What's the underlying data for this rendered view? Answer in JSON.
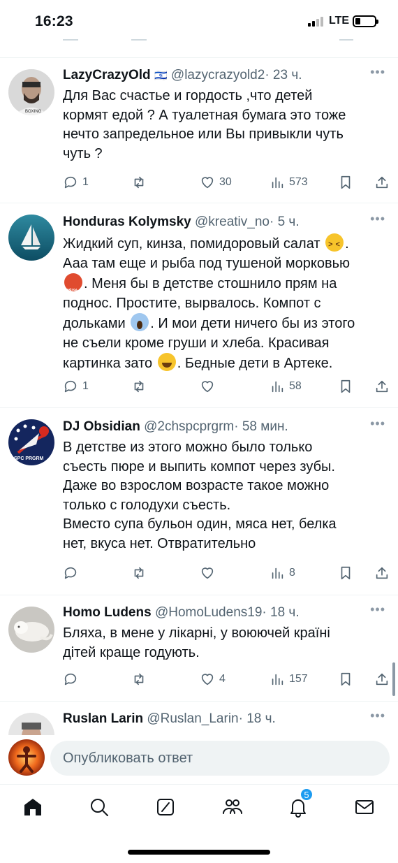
{
  "status_bar": {
    "time": "16:23",
    "network": "LTE"
  },
  "tweets": [
    {
      "name": "LazyCrazyOld",
      "flag": "🇮🇱",
      "handle": "@lazycrazyold2",
      "time": "· 23 ч.",
      "lines": [
        "Для Вас счастье и гордость ,что детей",
        "кормят едой ? А туалетная бумага это тоже",
        "нечто запредельное или Вы привыкли чуть",
        "чуть ?"
      ],
      "replies": "1",
      "retweets": "",
      "likes": "30",
      "views": "573"
    },
    {
      "name": "Honduras Kolymsky",
      "handle": "@kreativ_no",
      "time": "· 5 ч.",
      "lines": [
        "Жидкий суп, кинза, помидоровый салат",
        "Ааа там еще и рыба под тушеной морковью",
        ". Меня бы в детстве стошнило прям на",
        "поднос. Простите, вырвалось. Компот с",
        "дольками",
        ". И мои дети ничего бы из этого",
        "не съели кроме груши и хлеба. Красивая",
        "картинка зато",
        ". Бедные дети в Артеке."
      ],
      "replies": "1",
      "retweets": "",
      "likes": "",
      "views": "58"
    },
    {
      "name": "DJ Obsidian",
      "handle": "@2chspcprgrm",
      "time": "· 58 мин.",
      "avatar_text": "SPC PRGRM",
      "lines": [
        "В детстве из этого можно было только",
        "съесть пюре и выпить компот через зубы.",
        "Даже во взрослом возрасте такое можно",
        "только с голодухи съесть.",
        "Вместо супа бульон один, мяса нет, белка",
        "нет, вкуса нет. Отвратительно"
      ],
      "replies": "",
      "retweets": "",
      "likes": "",
      "views": "8"
    },
    {
      "name": "Homo Ludens",
      "handle": "@HomoLudens19",
      "time": "· 18 ч.",
      "lines": [
        "Бляха, в мене у лікарні, у воюючей країні",
        "дітей краще годують."
      ],
      "replies": "",
      "retweets": "",
      "likes": "4",
      "views": "157"
    },
    {
      "name": "Ruslan Larin",
      "handle": "@Ruslan_Larin",
      "time": "· 18 ч."
    }
  ],
  "reply_bar": {
    "placeholder": "Опубликовать ответ"
  },
  "tab_bar": {
    "notifications_badge": "5"
  },
  "colors": {
    "accent": "#1d9bf0",
    "secondary_text": "#536471",
    "divider": "#eff3f4"
  }
}
